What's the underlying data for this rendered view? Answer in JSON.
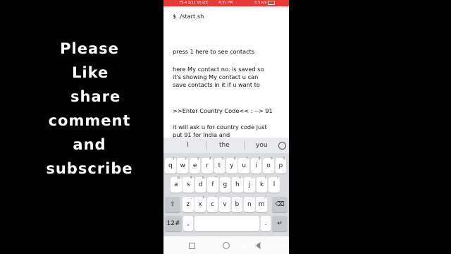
{
  "side_text": [
    "Please",
    "Like",
    "share",
    "comment",
    "and",
    "subscribe"
  ],
  "status_bar": {
    "left": "75.4 S/11 Vo LTE",
    "time": "4:31 PM",
    "right": "8.5 K/s"
  },
  "terminal": {
    "lines": [
      "$ ./start.sh",
      "press 1 here to see contacts",
      "here My contact no.  is saved so",
      "it's showing My contact u can",
      "save contacts in it if u want to",
      ">>Enter Country Code<< :  --> 91",
      "it will ask u for country code just",
      "put 91 for India and"
    ]
  },
  "keyboard": {
    "suggestions": [
      "l",
      "the",
      "you"
    ],
    "row1": [
      {
        "k": "q",
        "h": "1"
      },
      {
        "k": "w",
        "h": "2"
      },
      {
        "k": "e",
        "h": "3"
      },
      {
        "k": "r",
        "h": "4"
      },
      {
        "k": "t",
        "h": "5"
      },
      {
        "k": "y",
        "h": "6"
      },
      {
        "k": "u",
        "h": "7"
      },
      {
        "k": "i",
        "h": "8"
      },
      {
        "k": "o",
        "h": "9"
      },
      {
        "k": "p",
        "h": "0"
      }
    ],
    "row2": [
      {
        "k": "a",
        "h": "@"
      },
      {
        "k": "s",
        "h": "#"
      },
      {
        "k": "d",
        "h": "&"
      },
      {
        "k": "f",
        "h": "*"
      },
      {
        "k": "g",
        "h": "-"
      },
      {
        "k": "h",
        "h": "+"
      },
      {
        "k": "j",
        "h": "="
      },
      {
        "k": "k",
        "h": "("
      },
      {
        "k": "l",
        "h": ")"
      }
    ],
    "row3": [
      {
        "k": "z",
        "h": "_"
      },
      {
        "k": "x",
        "h": "$"
      },
      {
        "k": "c",
        "h": "\""
      },
      {
        "k": "v",
        "h": "'"
      },
      {
        "k": "b",
        "h": ":"
      },
      {
        "k": "n",
        "h": ";"
      },
      {
        "k": "m",
        "h": "/"
      }
    ],
    "shift_icon": "shift-icon",
    "backspace_icon": "backspace-icon",
    "symbols_label": "12#",
    "comma_label": ",",
    "period_label": ".",
    "enter_icon": "enter-icon"
  },
  "watermark": "DU Recorder"
}
